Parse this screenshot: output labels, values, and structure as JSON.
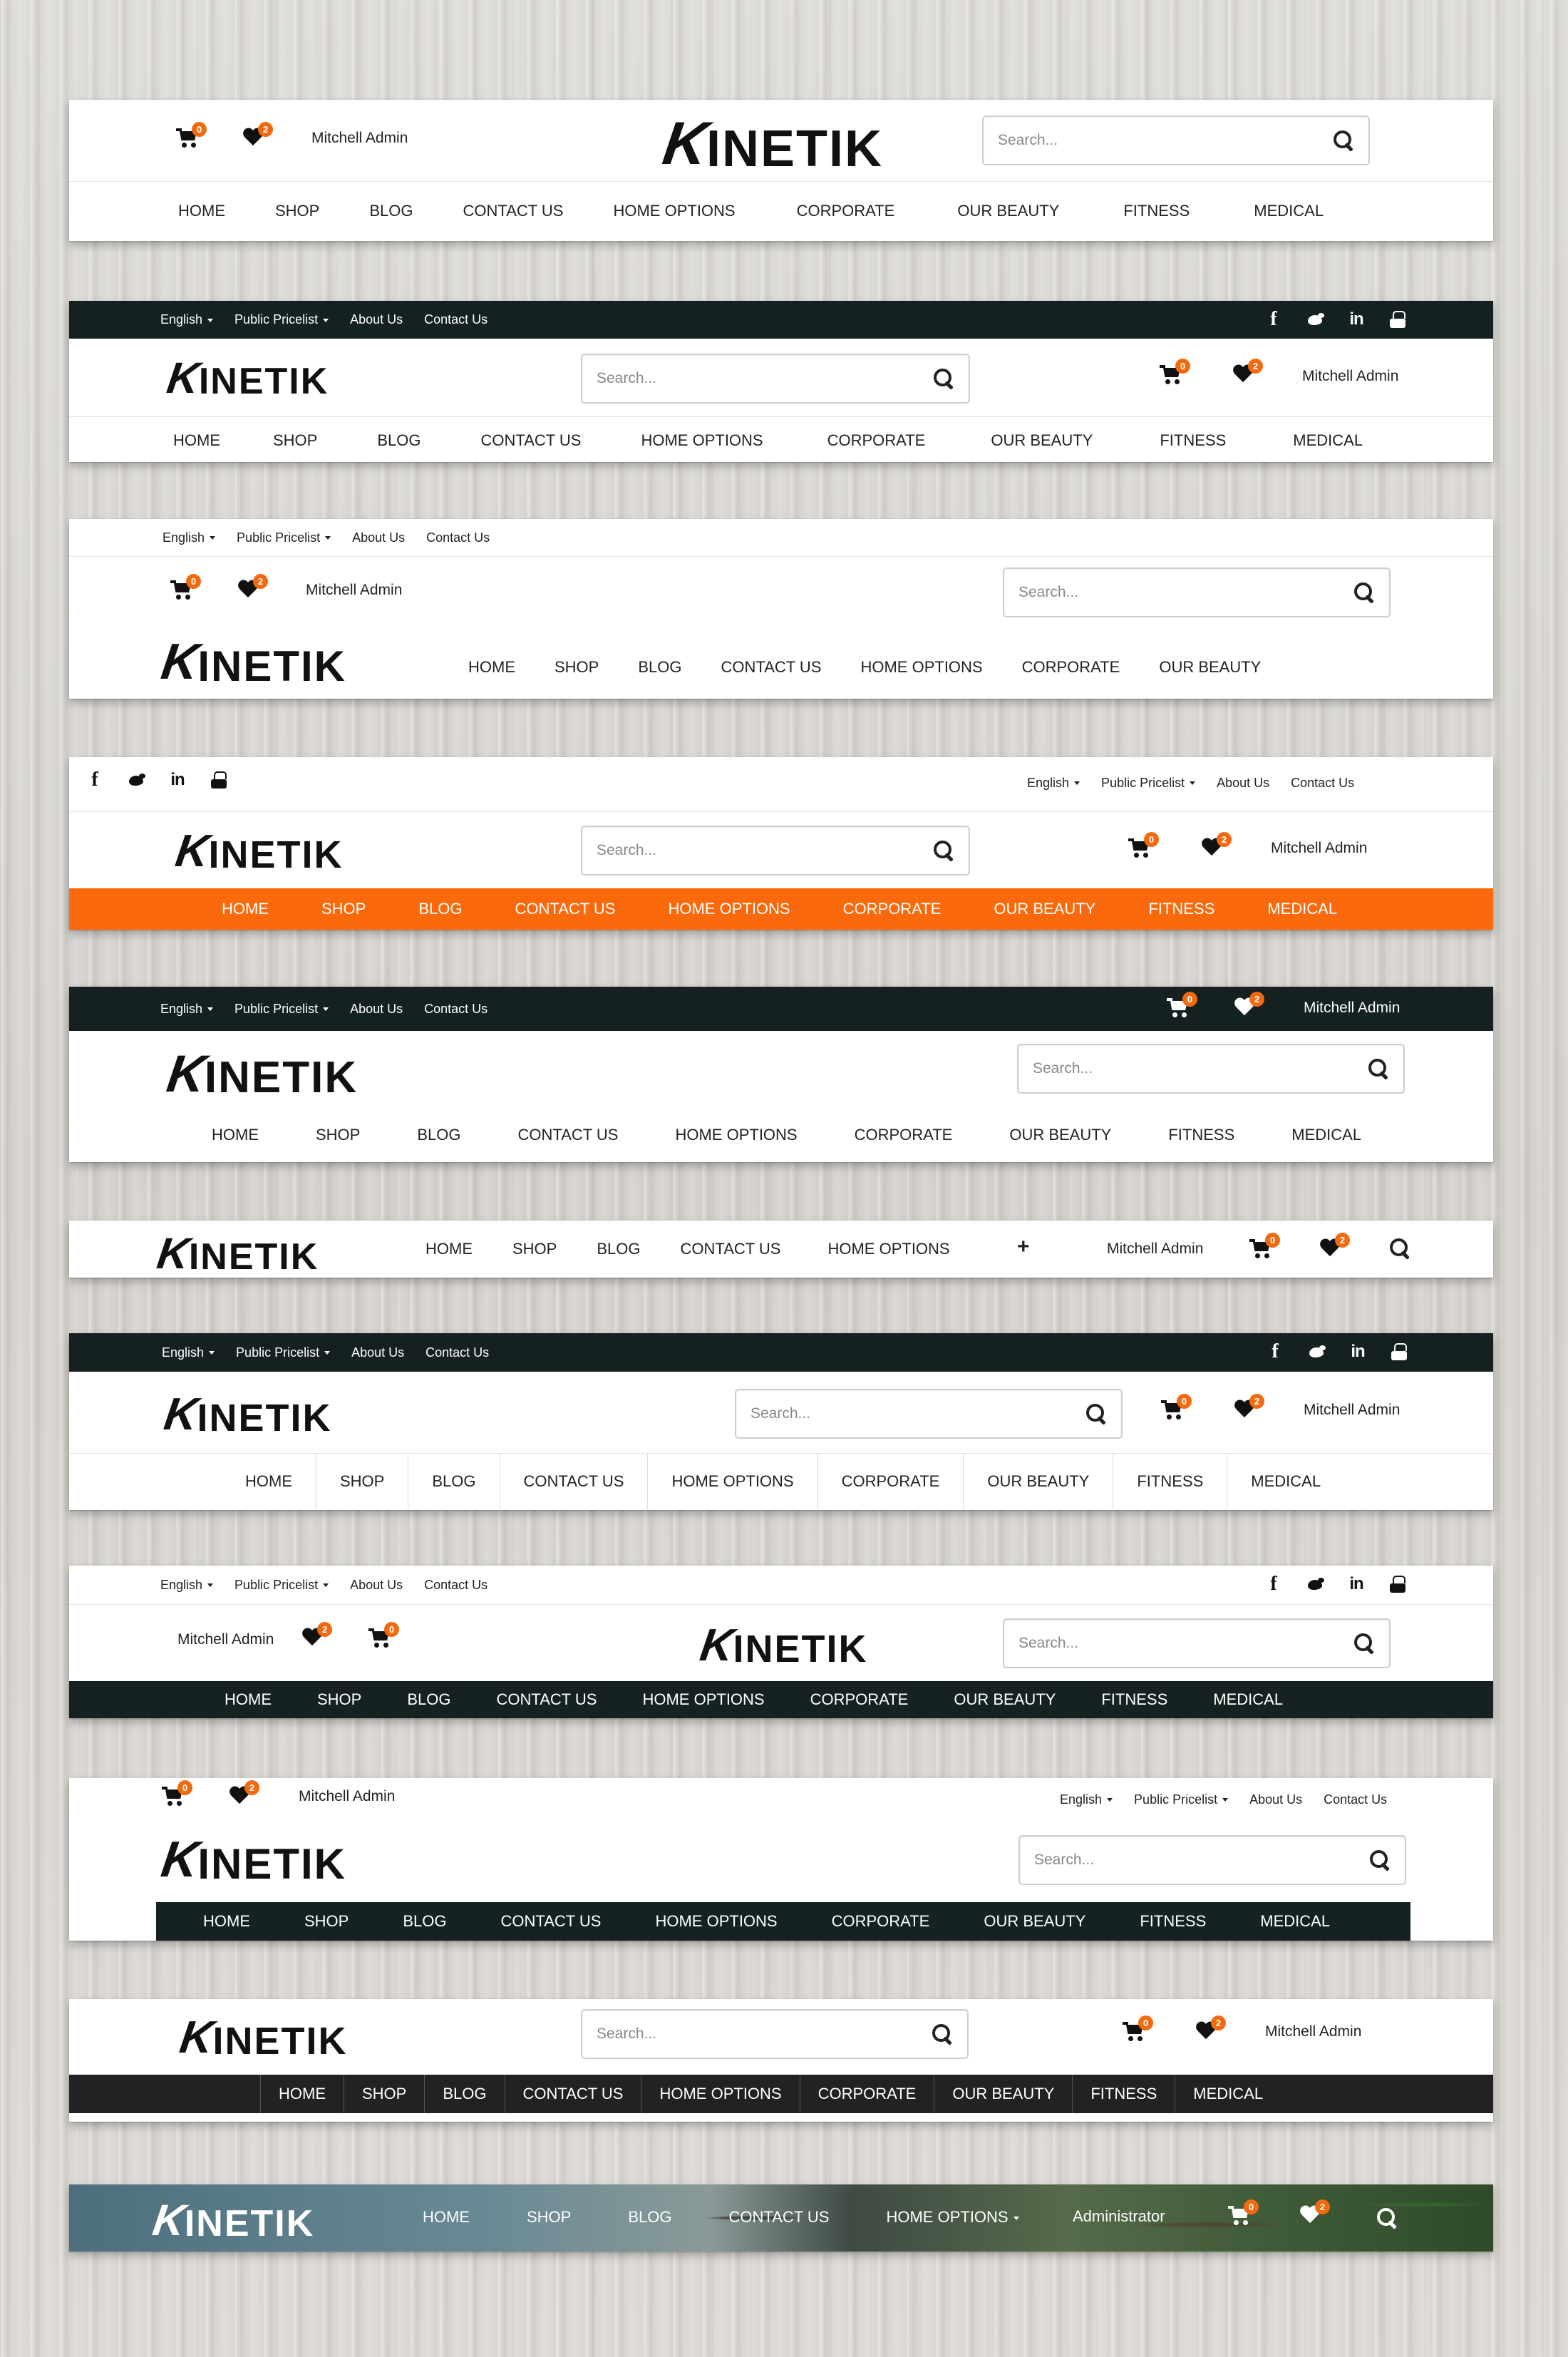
{
  "logo_text": "INETIK",
  "logo_k": "K",
  "search_placeholder": "Search...",
  "user_name": "Mitchell Admin",
  "admin_name": "Administrator",
  "cart_count": "0",
  "wishlist_count": "2",
  "top_links": [
    "English",
    "Public Pricelist",
    "About Us",
    "Contact Us"
  ],
  "social_icons": [
    "facebook-icon",
    "twitter-icon",
    "linkedin-icon",
    "youtube-icon"
  ],
  "nav_items": [
    "HOME",
    "SHOP",
    "BLOG",
    "CONTACT US",
    "HOME OPTIONS",
    "CORPORATE",
    "OUR BEAUTY",
    "FITNESS",
    "MEDICAL"
  ],
  "colors": {
    "accent": "#fa6a0c",
    "dark_bar": "#152020",
    "badge": "#f26a0f"
  },
  "headers": [
    {
      "id": 1,
      "style": "centered-logo"
    },
    {
      "id": 2,
      "style": "dark-topbar"
    },
    {
      "id": 3,
      "style": "light-topbar-inline-nav"
    },
    {
      "id": 4,
      "style": "orange-nav"
    },
    {
      "id": 5,
      "style": "dark-topbar-cart"
    },
    {
      "id": 6,
      "style": "single-line"
    },
    {
      "id": 7,
      "style": "separated-nav"
    },
    {
      "id": 8,
      "style": "centered-logo-dark-nav"
    },
    {
      "id": 9,
      "style": "boxed-dark-nav"
    },
    {
      "id": 10,
      "style": "dark-separated-nav"
    },
    {
      "id": 11,
      "style": "image-background"
    }
  ]
}
